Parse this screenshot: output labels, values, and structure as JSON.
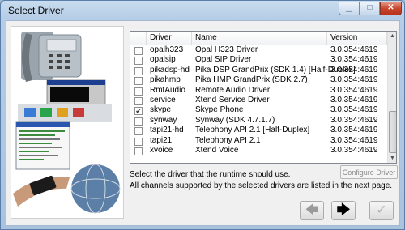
{
  "window": {
    "title": "Select Driver",
    "controls": {
      "minimize": "▁",
      "maximize": "□",
      "close": "✕"
    }
  },
  "table": {
    "columns": [
      "Driver",
      "Name",
      "Version"
    ],
    "rows": [
      {
        "checked": false,
        "driver": "opalh323",
        "name": "Opal H323 Driver",
        "version": "3.0.354:4619"
      },
      {
        "checked": false,
        "driver": "opalsip",
        "name": "Opal SIP Driver",
        "version": "3.0.354:4619"
      },
      {
        "checked": false,
        "driver": "pikadsp-hd",
        "name": "Pika DSP GrandPrix (SDK 1.4) [Half-Duplex]",
        "version": "3.0.354:4619"
      },
      {
        "checked": false,
        "driver": "pikahmp",
        "name": "Pika HMP GrandPrix (SDK 2.7)",
        "version": "3.0.354:4619"
      },
      {
        "checked": false,
        "driver": "RmtAudio",
        "name": "Remote Audio Driver",
        "version": "3.0.354:4619"
      },
      {
        "checked": false,
        "driver": "service",
        "name": "Xtend Service Driver",
        "version": "3.0.354:4619"
      },
      {
        "checked": true,
        "driver": "skype",
        "name": "Skype Phone",
        "version": "3.0.354:4619"
      },
      {
        "checked": false,
        "driver": "synway",
        "name": "Synway (SDK 4.7.1.7)",
        "version": "3.0.354:4619"
      },
      {
        "checked": false,
        "driver": "tapi21-hd",
        "name": "Telephony API 2.1 [Half-Duplex]",
        "version": "3.0.354:4619"
      },
      {
        "checked": false,
        "driver": "tapi21",
        "name": "Telephony API 2.1",
        "version": "3.0.354:4619"
      },
      {
        "checked": false,
        "driver": "xvoice",
        "name": "Xtend Voice",
        "version": "3.0.354:4619"
      }
    ]
  },
  "buttons": {
    "configure": "Configure Driver",
    "back": "🡄",
    "next": "🡆",
    "finish": "✓"
  },
  "info": {
    "line1": "Select the driver that the runtime should use.",
    "line2": "All channels supported by the selected drivers are listed in the next page."
  }
}
